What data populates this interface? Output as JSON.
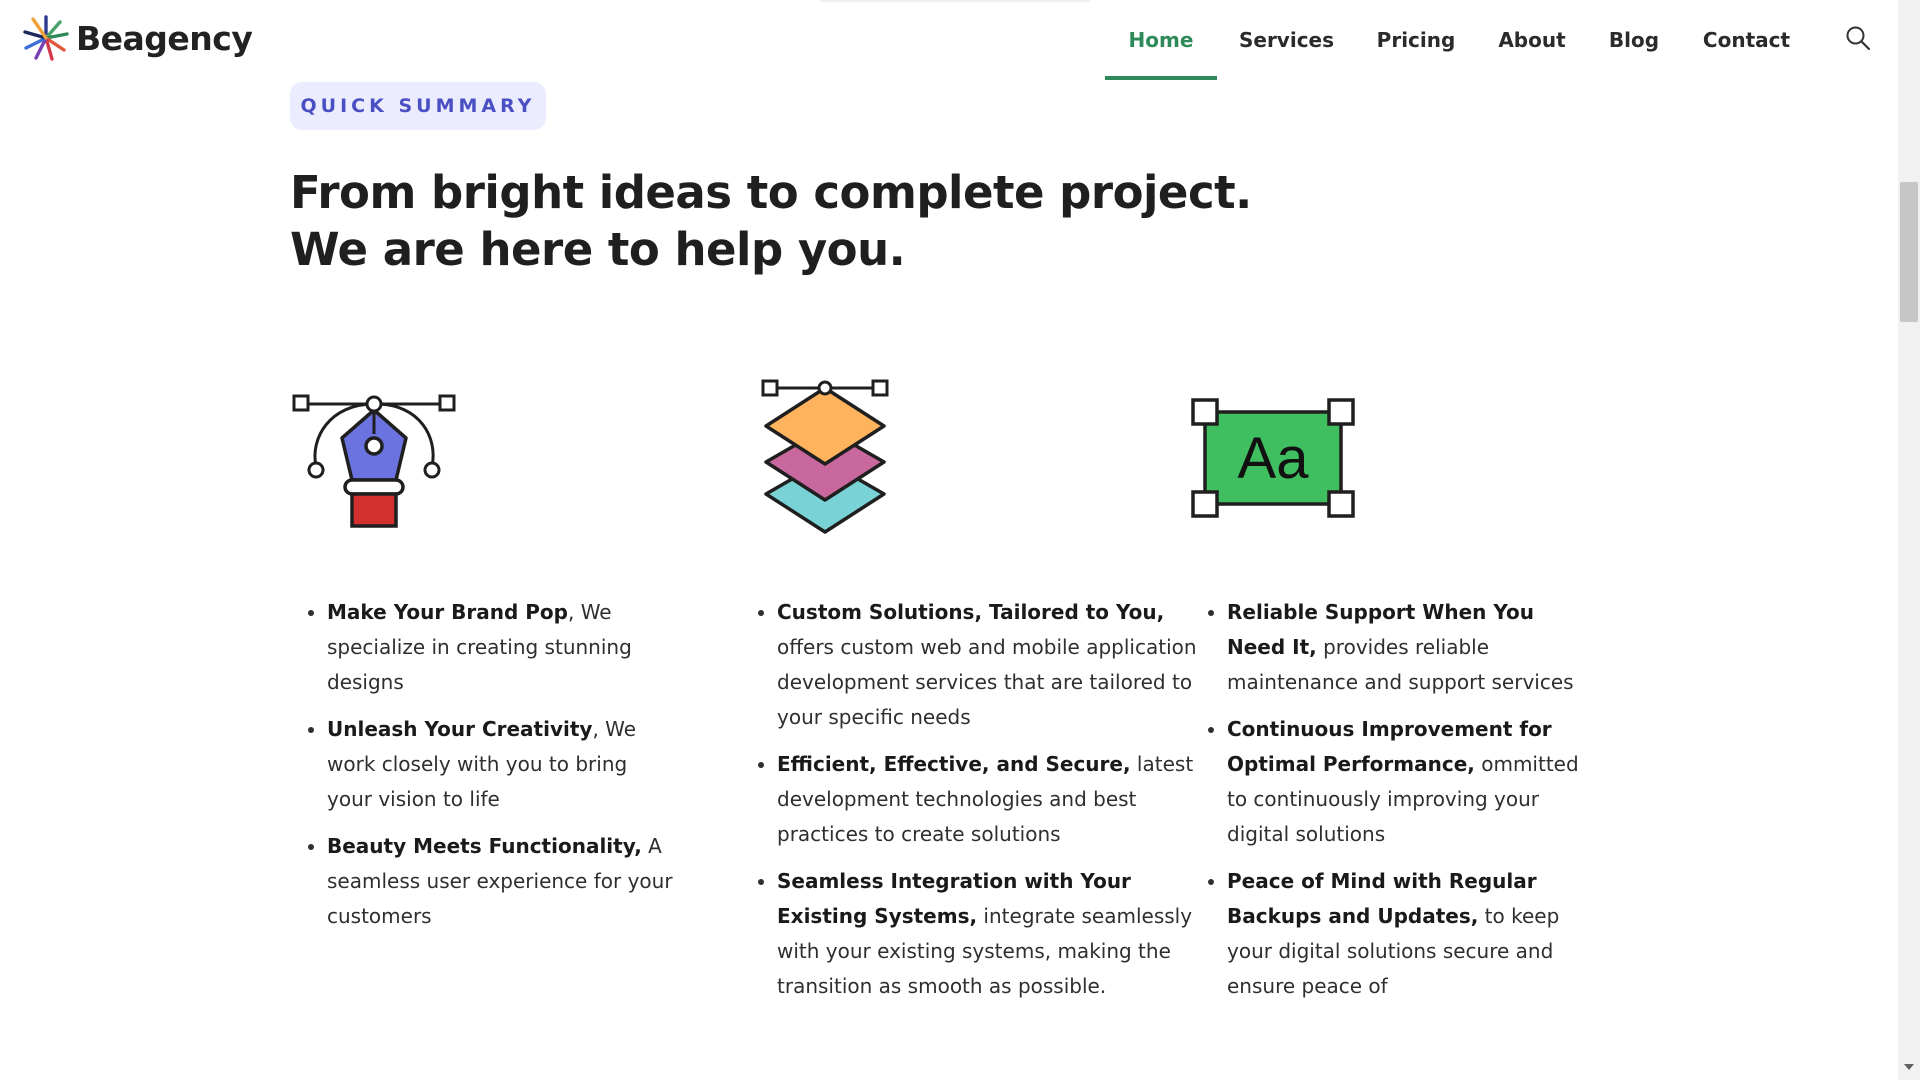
{
  "brand": {
    "name": "Beagency"
  },
  "nav": {
    "items": [
      {
        "label": "Home",
        "active": true
      },
      {
        "label": "Services"
      },
      {
        "label": "Pricing"
      },
      {
        "label": "About"
      },
      {
        "label": "Blog"
      },
      {
        "label": "Contact"
      }
    ],
    "search_icon": "search-icon"
  },
  "section": {
    "badge": "QUICK SUMMARY",
    "headline_line1": "From bright ideas to complete project.",
    "headline_line2": "We are here to help you."
  },
  "features": [
    {
      "icon": "pen-tool-icon",
      "items": [
        {
          "bold": "Make Your Brand Pop",
          "text": ", We specialize in creating stunning designs"
        },
        {
          "bold": "Unleash Your Creativity",
          "text": ", We work closely with you to bring your vision to life"
        },
        {
          "bold": " Beauty Meets Functionality,",
          "text": " A seamless user experience for your customers"
        }
      ]
    },
    {
      "icon": "layers-icon",
      "items": [
        {
          "bold": "Custom Solutions, Tailored to You,",
          "text": " offers custom web and mobile application development services that are tailored to your specific needs"
        },
        {
          "bold": "Efficient, Effective, and Secure,",
          "text": " latest development technologies and best practices to create solutions"
        },
        {
          "bold": "Seamless Integration with Your Existing Systems,",
          "text": " integrate seamlessly with your existing systems, making the transition as smooth as possible."
        }
      ]
    },
    {
      "icon": "typography-icon",
      "icon_text": "Aa",
      "items": [
        {
          "bold": "Reliable Support When You Need It,",
          "text": " provides reliable maintenance and support services"
        },
        {
          "bold": "Continuous Improvement for Optimal Performance,",
          "text": " ommitted to continuously improving your digital solutions"
        },
        {
          "bold": "Peace of Mind with Regular Backups and Updates,",
          "text": "  to keep your digital solutions secure and ensure peace of"
        }
      ]
    }
  ],
  "colors": {
    "accent": "#2f8a5a",
    "badge_bg": "#ececff",
    "badge_text": "#4b4fc4",
    "pen_body": "#6b73e0",
    "pen_base": "#d22f2f",
    "layer_top": "#ffb35c",
    "layer_mid": "#c8689e",
    "layer_bottom": "#79d2d6",
    "typo_bg": "#3fbf5f"
  }
}
